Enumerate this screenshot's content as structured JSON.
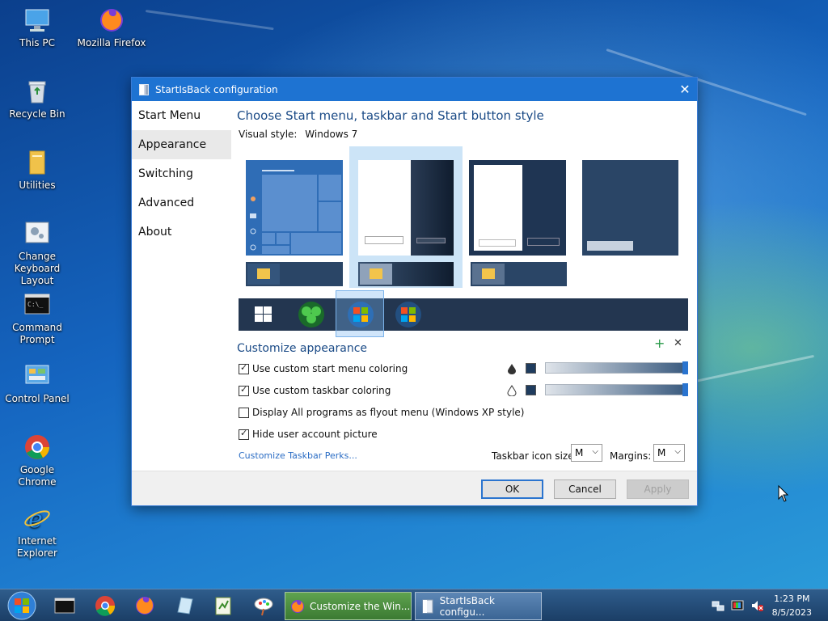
{
  "desktop": {
    "icons": [
      {
        "label": "This PC",
        "icon": "computer-icon"
      },
      {
        "label": "Mozilla Firefox",
        "icon": "firefox-icon"
      },
      {
        "label": "Recycle Bin",
        "icon": "recycle-bin-icon"
      },
      {
        "label": "Utilities",
        "icon": "folder-icon"
      },
      {
        "label": "Change Keyboard Layout",
        "icon": "keyboard-settings-icon"
      },
      {
        "label": "Command Prompt",
        "icon": "cmd-icon"
      },
      {
        "label": "Control Panel",
        "icon": "control-panel-icon"
      },
      {
        "label": "Google Chrome",
        "icon": "chrome-icon"
      },
      {
        "label": "Internet Explorer",
        "icon": "ie-icon"
      }
    ]
  },
  "window": {
    "title": "StartIsBack configuration",
    "close_glyph": "✕",
    "nav": [
      {
        "label": "Start Menu"
      },
      {
        "label": "Appearance"
      },
      {
        "label": "Switching"
      },
      {
        "label": "Advanced"
      },
      {
        "label": "About"
      }
    ],
    "heading": "Choose Start menu, taskbar and Start button style",
    "visual_style_label": "Visual style:",
    "visual_style_value": "Windows 7",
    "customize_heading": "Customize appearance",
    "plus_glyph": "+",
    "x_glyph": "✕",
    "options": [
      {
        "label": "Use custom start menu coloring",
        "checked": true
      },
      {
        "label": "Use custom taskbar coloring",
        "checked": true
      },
      {
        "label": "Display All programs as flyout menu (Windows XP style)",
        "checked": false
      },
      {
        "label": "Hide user account picture",
        "checked": true
      }
    ],
    "perks_link": "Customize Taskbar Perks...",
    "taskbar_icon_size_label": "Taskbar icon size:",
    "taskbar_icon_size_value": "M",
    "margins_label": "Margins:",
    "margins_value": "M",
    "buttons": {
      "ok": "OK",
      "cancel": "Cancel",
      "apply": "Apply"
    },
    "colors": {
      "accent": "#1e73d2",
      "swatch": "#1f3c5e"
    }
  },
  "taskbar": {
    "tasks": [
      {
        "label": "Customize the Win...",
        "icon": "firefox-icon"
      },
      {
        "label": "StartIsBack configu...",
        "icon": "startisback-icon"
      }
    ],
    "time": "1:23 PM",
    "date": "8/5/2023"
  }
}
